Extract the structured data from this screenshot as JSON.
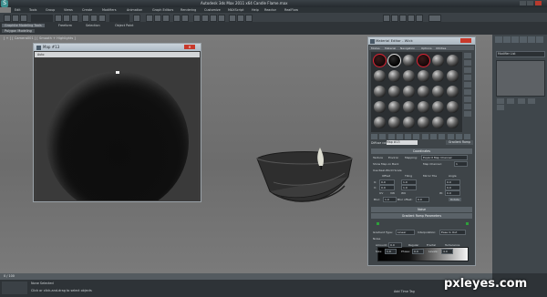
{
  "window": {
    "title": "Autodesk 3ds Max 2011 x64    Candle Flame.max",
    "logo": "3ds-max-logo"
  },
  "menus": [
    "Edit",
    "Tools",
    "Group",
    "Views",
    "Create",
    "Modifiers",
    "Animation",
    "Graph Editors",
    "Rendering",
    "Customize",
    "MAXScript",
    "Help",
    "Reactor",
    "RealFlow"
  ],
  "ribbon": {
    "tabs": [
      "Graphite Modeling Tools",
      "Freeform",
      "Selection",
      "Object Paint"
    ],
    "active_tab": "Graphite Modeling Tools",
    "sub_label": "Polygon Modeling"
  },
  "viewport": {
    "label": "[ + ] [ Camera001 ] [ Smooth + Highlights ]"
  },
  "map_window": {
    "title": "Map #13",
    "toolbar_text": "Auto"
  },
  "material_editor": {
    "title": "Material Editor - Wick",
    "menus": [
      "Modes",
      "Material",
      "Navigation",
      "Options",
      "Utilities"
    ],
    "name_label": "Diffuse color:",
    "name_value": "Map #13",
    "type_button": "Gradient Ramp",
    "rollouts": {
      "coordinates": "Coordinates",
      "noise": "Noise",
      "gradient_ramp_params": "Gradient Ramp Parameters"
    },
    "coord_fields": {
      "texture": "Texture",
      "environ": "Environ",
      "mapping_label": "Mapping:",
      "mapping_value": "Explicit Map Channel",
      "map_channel_label": "Map Channel:",
      "map_channel_value": "1",
      "show_map_back": "Show Map on Back",
      "use_real_world": "Use Real-World Scale",
      "offset": "Offset",
      "tiling": "Tiling",
      "mirror_tile": "Mirror Tile",
      "angle": "Angle",
      "u_label": "U:",
      "v_label": "V:",
      "w_label": "W:",
      "offset_u": "0.0",
      "offset_v": "0.0",
      "tiling_u": "1.0",
      "tiling_v": "1.0",
      "angle_u": "0.0",
      "angle_v": "0.0",
      "angle_w": "0.0",
      "uv": "UV",
      "vw": "VW",
      "wu": "WU",
      "blur_label": "Blur:",
      "blur_value": "1.0",
      "blur_offset_label": "Blur offset:",
      "blur_offset_value": "0.0",
      "rotate": "Rotate"
    },
    "gradient_fields": {
      "gradient_type_label": "Gradient Type:",
      "gradient_type_value": "Linear",
      "interpolation_label": "Interpolation:",
      "interpolation_value": "Ease In Out",
      "noise_label": "Noise",
      "amount_label": "Amount:",
      "amount_value": "0.0",
      "regular": "Regular",
      "fractal": "Fractal",
      "turbulence": "Turbulence",
      "size_label": "Size:",
      "size_value": "1.0",
      "phase_label": "Phase:",
      "phase_value": "0.0",
      "levels_label": "Levels:",
      "levels_value": "4.0"
    }
  },
  "command_panel": {
    "field_text": "Modifier List"
  },
  "status": {
    "slider": "0 / 100",
    "selection": "None Selected",
    "prompt": "Click or click-and-drag to select objects",
    "add_time_tag": "Add Time Tag"
  },
  "watermark": "pxleyes.com"
}
